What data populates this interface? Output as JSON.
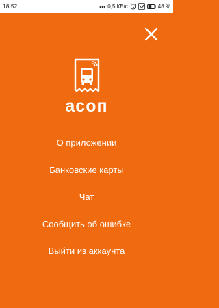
{
  "status_bar": {
    "time": "18:52",
    "speed": "0,5 КБ/с",
    "battery_percent": "48 %",
    "icons": [
      "signal-dots-icon",
      "alarm-icon",
      "volte-icon",
      "battery-icon"
    ]
  },
  "colors": {
    "background": "#f06a10",
    "foreground": "#ffffff",
    "status_bar": "#ffffff"
  },
  "header": {
    "close_icon": "close-icon"
  },
  "logo": {
    "icon": "bus-ticket-icon",
    "wordmark": "асоп"
  },
  "menu": {
    "items": [
      {
        "label": "О приложении"
      },
      {
        "label": "Банковские карты"
      },
      {
        "label": "Чат"
      },
      {
        "label": "Сообщить об ошибке"
      },
      {
        "label": "Выйти из аккаунта"
      }
    ]
  }
}
